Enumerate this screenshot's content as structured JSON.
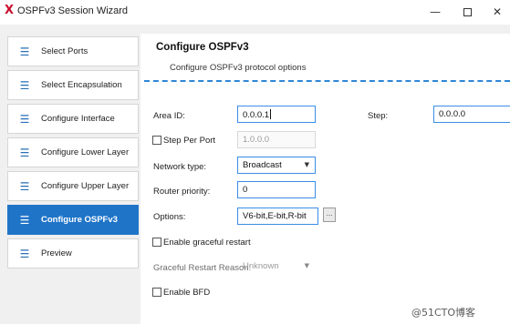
{
  "window": {
    "title": "OSPFv3 Session Wizard",
    "logo_glyph": "X",
    "minimize_glyph": "—",
    "close_glyph": "✕"
  },
  "sidebar": {
    "items": [
      {
        "label": "Select Ports",
        "icon": "list-icon",
        "glyph": "☰",
        "active": false
      },
      {
        "label": "Select Encapsulation",
        "icon": "list-icon",
        "glyph": "☰",
        "active": false
      },
      {
        "label": "Configure Interface",
        "icon": "list-icon",
        "glyph": "☰",
        "active": false
      },
      {
        "label": "Configure Lower Layer",
        "icon": "list-icon",
        "glyph": "☰",
        "active": false
      },
      {
        "label": "Configure Upper Layer",
        "icon": "list-icon",
        "glyph": "☰",
        "active": false
      },
      {
        "label": "Configure OSPFv3",
        "icon": "list-icon",
        "glyph": "☰",
        "active": true
      },
      {
        "label": "Preview",
        "icon": "list-icon",
        "glyph": "☰",
        "active": false
      }
    ]
  },
  "main": {
    "title": "Configure OSPFv3",
    "subtitle": "Configure OSPFv3 protocol options",
    "area_id": {
      "label": "Area ID:",
      "value": "0.0.0.1"
    },
    "step": {
      "label": "Step:",
      "value": "0.0.0.0"
    },
    "step_per_port": {
      "label": "Step Per Port",
      "value": "1.0.0.0",
      "checked": false
    },
    "network_type": {
      "label": "Network type:",
      "value": "Broadcast"
    },
    "router_priority": {
      "label": "Router priority:",
      "value": "0"
    },
    "options": {
      "label": "Options:",
      "value": "V6-bit,E-bit,R-bit",
      "button_label": "..."
    },
    "graceful_restart": {
      "label": "Enable graceful restart",
      "checked": false
    },
    "graceful_restart_reason": {
      "label": "Graceful Restart Reason:",
      "value": "Unknown"
    },
    "enable_bfd": {
      "label": "Enable BFD",
      "checked": false
    },
    "dropdown_glyph": "▼"
  },
  "watermark": "@51CTO博客",
  "colors": {
    "accent": "#1f74c8",
    "field_border": "#3a8ee6",
    "separator": "#2f86d6",
    "logo": "#c8102e"
  }
}
